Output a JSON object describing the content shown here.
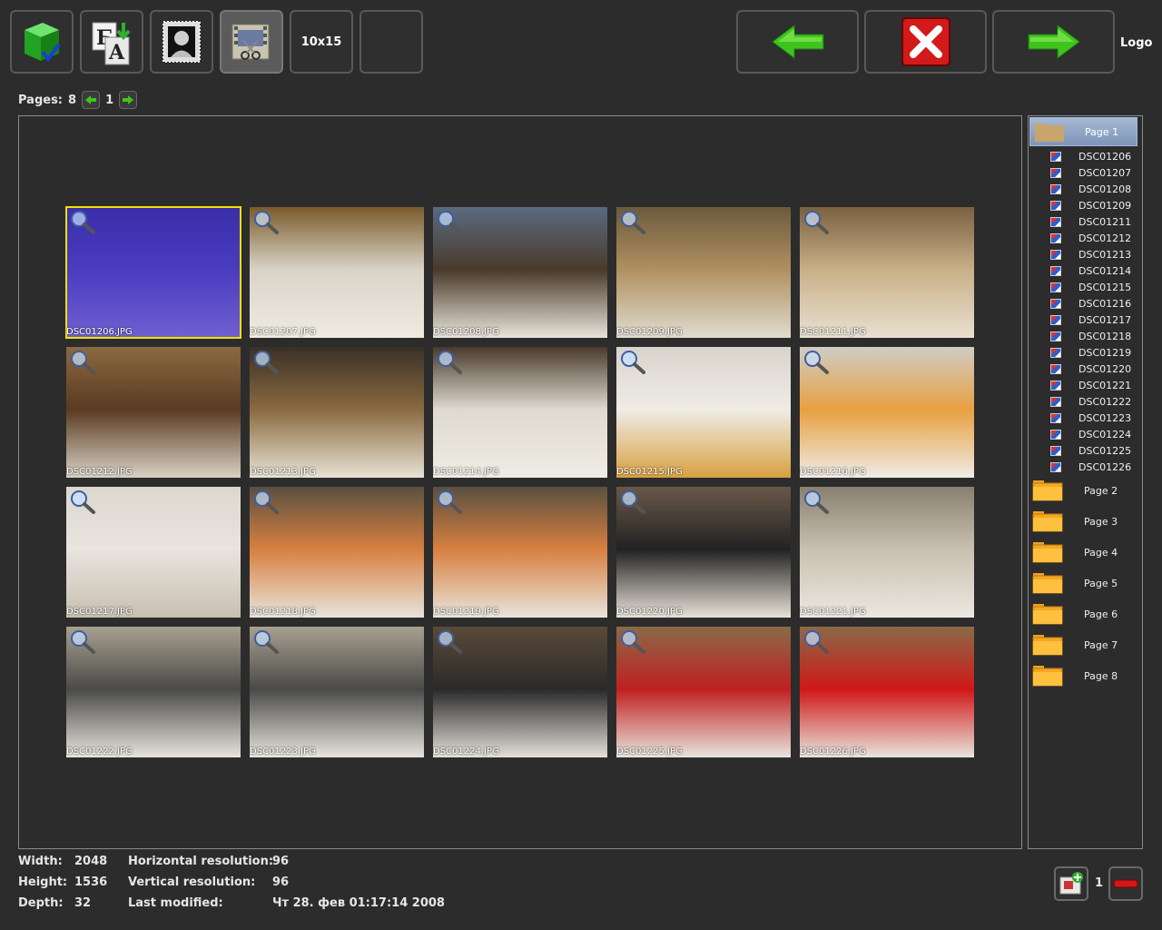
{
  "toolbar": {
    "size_label": "10x15",
    "logo": "Logo"
  },
  "pages_bar": {
    "label": "Pages:",
    "total": "8",
    "current": "1"
  },
  "thumbnails": [
    {
      "caption": "DSC01206.JPG",
      "colors": [
        "#3a2ea8",
        "#4a3cc0",
        "#7060d0"
      ],
      "selected": true
    },
    {
      "caption": "DSC01207.JPG",
      "colors": [
        "#7a5a2a",
        "#d9d4c8",
        "#efebe0"
      ]
    },
    {
      "caption": "DSC01208.JPG",
      "colors": [
        "#5a6a80",
        "#4a3a2a",
        "#e8e4da"
      ]
    },
    {
      "caption": "DSC01209.JPG",
      "colors": [
        "#6b5a3e",
        "#b09060",
        "#e0dccf"
      ]
    },
    {
      "caption": "DSC01211.JPG",
      "colors": [
        "#7a6040",
        "#c8b088",
        "#e8e0d0"
      ]
    },
    {
      "caption": "DSC01212.JPG",
      "colors": [
        "#8a6a40",
        "#5a3a22",
        "#d8d2c4"
      ]
    },
    {
      "caption": "DSC01213.JPG",
      "colors": [
        "#3a3028",
        "#8a6a40",
        "#e8e2d4"
      ]
    },
    {
      "caption": "DSC01214.JPG",
      "colors": [
        "#4a3a2c",
        "#dedad0",
        "#efece4"
      ]
    },
    {
      "caption": "DSC01215.JPG",
      "colors": [
        "#d8d4cc",
        "#efece6",
        "#d8a040"
      ]
    },
    {
      "caption": "DSC01216.JPG",
      "colors": [
        "#d0ccc4",
        "#e8a040",
        "#efece6"
      ]
    },
    {
      "caption": "DSC01217.JPG",
      "colors": [
        "#dcd8d0",
        "#e8e4de",
        "#c8c0b0"
      ]
    },
    {
      "caption": "DSC01218.JPG",
      "colors": [
        "#5a5040",
        "#d88040",
        "#e8e4dc"
      ]
    },
    {
      "caption": "DSC01219.JPG",
      "colors": [
        "#5a5040",
        "#d88040",
        "#e8e4dc"
      ]
    },
    {
      "caption": "DSC01220.JPG",
      "colors": [
        "#6a5848",
        "#222222",
        "#e8e2d8"
      ]
    },
    {
      "caption": "DSC01221.JPG",
      "colors": [
        "#8a8070",
        "#c8c0b0",
        "#ece8e0"
      ]
    },
    {
      "caption": "DSC01222.JPG",
      "colors": [
        "#a8a090",
        "#4a4a48",
        "#e8e4dc"
      ]
    },
    {
      "caption": "DSC01223.JPG",
      "colors": [
        "#a8a090",
        "#4a4a48",
        "#e8e4dc"
      ]
    },
    {
      "caption": "DSC01224.JPG",
      "colors": [
        "#5a4a38",
        "#2a2a2a",
        "#e4e0d8"
      ]
    },
    {
      "caption": "DSC01225.JPG",
      "colors": [
        "#8a6a48",
        "#c02020",
        "#e8e4dc"
      ]
    },
    {
      "caption": "DSC01226.JPG",
      "colors": [
        "#8a6a48",
        "#d01818",
        "#e8e4dc"
      ]
    }
  ],
  "tree": {
    "selected_page": "Page 1",
    "files": [
      "DSC01206",
      "DSC01207",
      "DSC01208",
      "DSC01209",
      "DSC01211",
      "DSC01212",
      "DSC01213",
      "DSC01214",
      "DSC01215",
      "DSC01216",
      "DSC01217",
      "DSC01218",
      "DSC01219",
      "DSC01220",
      "DSC01221",
      "DSC01222",
      "DSC01223",
      "DSC01224",
      "DSC01225",
      "DSC01226"
    ],
    "pages": [
      "Page 2",
      "Page 3",
      "Page 4",
      "Page 5",
      "Page 6",
      "Page 7",
      "Page 8"
    ]
  },
  "info": {
    "width_label": "Width:",
    "width": "2048",
    "height_label": "Height:",
    "height": "1536",
    "depth_label": "Depth:",
    "depth": "32",
    "hres_label": "Horizontal resolution:",
    "hres": "96",
    "vres_label": "Vertical resolution:",
    "vres": "96",
    "modified_label": "Last modified:",
    "modified": "Чт 28. фев 01:17:14 2008"
  },
  "bottom": {
    "count": "1"
  },
  "icons": {
    "apply": "green-cube-checkmark-icon",
    "translate": "letters-b-a-icon",
    "portrait": "stamp-portrait-icon",
    "film": "filmstrip-scissors-icon",
    "back": "green-arrow-left-icon",
    "cancel": "red-x-icon",
    "next": "green-arrow-right-icon",
    "add_print": "add-print-icon",
    "remove": "red-minus-icon",
    "zoom": "magnifier-icon",
    "folder": "folder-icon",
    "image_file": "image-file-icon"
  }
}
